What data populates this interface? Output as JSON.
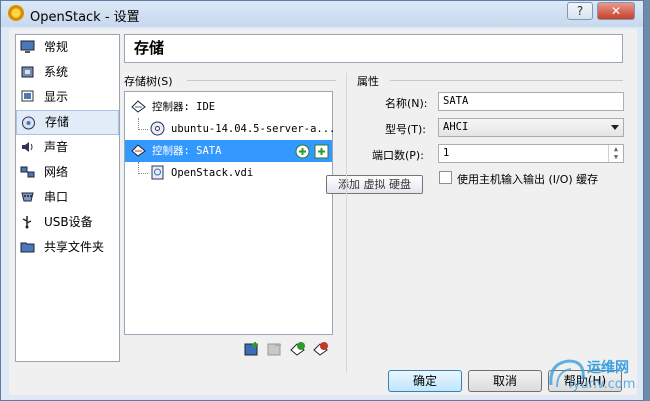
{
  "window": {
    "title": "OpenStack - 设置",
    "help_glyph": "?",
    "close_glyph": "✕"
  },
  "sidebar": {
    "items": [
      {
        "label": "常规",
        "icon": "general-monitor-icon"
      },
      {
        "label": "系统",
        "icon": "system-chip-icon"
      },
      {
        "label": "显示",
        "icon": "display-monitor-icon"
      },
      {
        "label": "存储",
        "icon": "storage-disk-icon"
      },
      {
        "label": "声音",
        "icon": "speaker-icon"
      },
      {
        "label": "网络",
        "icon": "network-icon"
      },
      {
        "label": "串口",
        "icon": "serial-port-icon"
      },
      {
        "label": "USB设备",
        "icon": "usb-icon"
      },
      {
        "label": "共享文件夹",
        "icon": "folder-icon"
      }
    ],
    "selected": "存储"
  },
  "page": {
    "title": "存储"
  },
  "tree": {
    "label": "存储树(S)",
    "nodes": [
      {
        "label": "控制器: IDE"
      },
      {
        "label": "ubuntu-14.04.5-server-a..."
      },
      {
        "label": "控制器: SATA"
      },
      {
        "label": "OpenStack.vdi"
      }
    ]
  },
  "tooltip": "添加 虚拟 硬盘",
  "attributes": {
    "label": "属性",
    "name_label": "名称(N):",
    "name_value": "SATA",
    "type_label": "型号(T):",
    "type_value": "AHCI",
    "ports_label": "端口数(P):",
    "ports_value": "1",
    "host_io_label": "使用主机输入输出 (I/O) 缓存"
  },
  "buttons": {
    "ok": "确定",
    "cancel": "取消",
    "help": "帮助(H)"
  },
  "watermark": {
    "text1": "运维网",
    "text2": "iyunv.com"
  },
  "colors": {
    "selection": "#3399ff",
    "titlebar": "#c7d9ee",
    "close": "#c6402b"
  }
}
